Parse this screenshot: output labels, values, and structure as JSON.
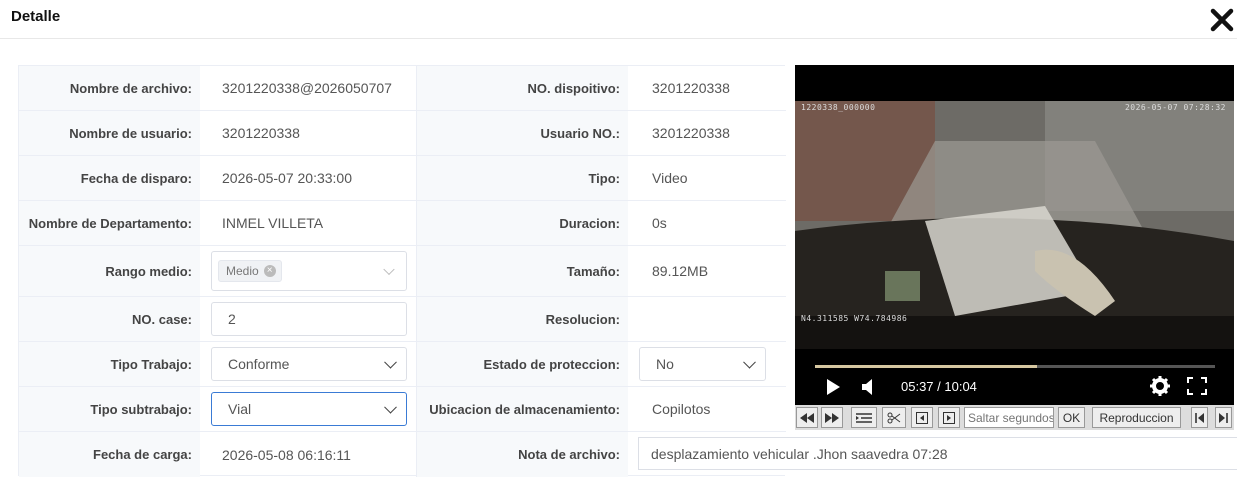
{
  "dialog": {
    "title": "Detalle"
  },
  "fields": {
    "file_name": {
      "label": "Nombre de archivo:",
      "value": "3201220338@2026050707"
    },
    "device_no": {
      "label": "NO. dispoitivo:",
      "value": "3201220338"
    },
    "user_name": {
      "label": "Nombre de usuario:",
      "value": "3201220338"
    },
    "user_no": {
      "label": "Usuario NO.:",
      "value": "3201220338"
    },
    "trigger_date": {
      "label": "Fecha de disparo:",
      "value": "2026-05-07 20:33:00"
    },
    "type": {
      "label": "Tipo:",
      "value": "Video"
    },
    "department": {
      "label": "Nombre de Departamento:",
      "value": "INMEL VILLETA"
    },
    "duration": {
      "label": "Duracion:",
      "value": "0s"
    },
    "range": {
      "label": "Rango medio:",
      "tag": "Medio"
    },
    "size": {
      "label": "Tamaño:",
      "value": "89.12MB"
    },
    "case_no": {
      "label": "NO. case:",
      "value": "2"
    },
    "resolution": {
      "label": "Resolucion:",
      "value": ""
    },
    "work_type": {
      "label": "Tipo Trabajo:",
      "value": "Conforme"
    },
    "protection": {
      "label": "Estado de proteccion:",
      "value": "No"
    },
    "subwork_type": {
      "label": "Tipo subtrabajo:",
      "value": "Vial"
    },
    "storage": {
      "label": "Ubicacion de almacenamiento:",
      "value": "Copilotos"
    },
    "upload_date": {
      "label": "Fecha de carga:",
      "value": "2026-05-08 06:16:11"
    },
    "note": {
      "label": "Nota de archivo:",
      "value": "desplazamiento vehicular .Jhon saavedra 07:28"
    }
  },
  "player": {
    "osd_top_left": "1220338_000000",
    "osd_top_right": "2026-05-07 07:28:32",
    "osd_bottom_left": "N4.311585 W74.784986",
    "time": "05:37 / 10:04",
    "progress": 0.555
  },
  "toolbar": {
    "seek_placeholder": "Saltar segundos",
    "ok_label": "OK",
    "playback_label": "Reproduccion"
  }
}
